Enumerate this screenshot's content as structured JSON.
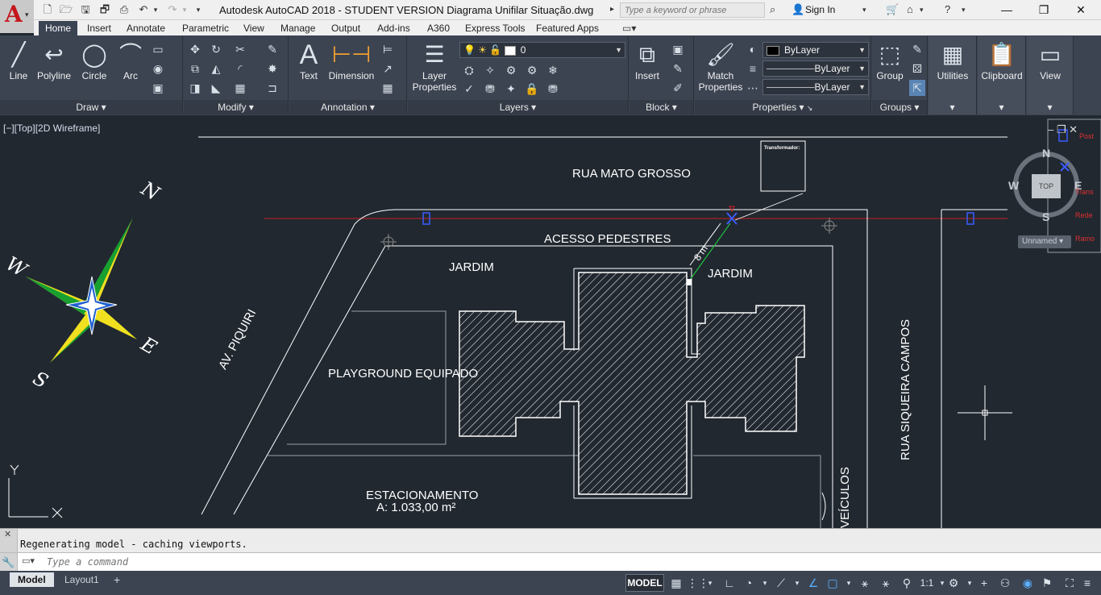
{
  "window": {
    "title": "Autodesk AutoCAD 2018 - STUDENT VERSION    Diagrama Unifilar Situação.dwg",
    "search_placeholder": "Type a keyword or phrase",
    "signin": "Sign In"
  },
  "ribbon_tabs": [
    "Home",
    "Insert",
    "Annotate",
    "Parametric",
    "View",
    "Manage",
    "Output",
    "Add-ins",
    "A360",
    "Express Tools",
    "Featured Apps"
  ],
  "ribbon": {
    "draw": {
      "title": "Draw",
      "line": "Line",
      "polyline": "Polyline",
      "circle": "Circle",
      "arc": "Arc"
    },
    "modify": {
      "title": "Modify"
    },
    "annotation": {
      "title": "Annotation",
      "text": "Text",
      "dimension": "Dimension"
    },
    "layers": {
      "title": "Layers",
      "layer_properties_1": "Layer",
      "layer_properties_2": "Properties",
      "current_layer": "0"
    },
    "block": {
      "title": "Block",
      "insert": "Insert"
    },
    "properties": {
      "title": "Properties",
      "match_1": "Match",
      "match_2": "Properties",
      "color": "ByLayer",
      "linetype": "ByLayer",
      "lineweight": "ByLayer"
    },
    "groups": {
      "title": "Groups",
      "group": "Group"
    },
    "utilities": {
      "label": "Utilities"
    },
    "clipboard": {
      "label": "Clipboard"
    },
    "view": {
      "label": "View"
    }
  },
  "viewport": {
    "label": "[−][Top][2D Wireframe]",
    "compass": {
      "n": "N",
      "s": "S",
      "e": "E",
      "w": "W"
    },
    "viewcube": {
      "n": "N",
      "s": "S",
      "e": "E",
      "w": "W",
      "face": "TOP",
      "ucs": "Unnamed"
    },
    "layers_list": [
      "Post",
      "Trans",
      "Rede",
      "Ramo"
    ],
    "labels": {
      "rua_mato_grosso": "RUA MATO GROSSO",
      "acesso_pedestres": "ACESSO PEDESTRES",
      "jardim_1": "JARDIM",
      "jardim_2": "JARDIM",
      "playground": "PLAYGROUND EQUIPADO",
      "av_piquiri": "AV. PIQUIRI",
      "estacionamento": "ESTACIONAMENTO",
      "area": "A: 1.033,00 m²",
      "rua_siqueira": "RUA SIQUEIRA CAMPOS",
      "veiculos": "VEÍCULOS",
      "distance": "8 m"
    },
    "transformer_note_title": "Transformador:"
  },
  "command": {
    "history": "Regenerating model - caching viewports.",
    "placeholder": "Type a command"
  },
  "status": {
    "tab_model": "Model",
    "tab_layout1": "Layout1",
    "model_btn": "MODEL",
    "scale": "1:1"
  }
}
